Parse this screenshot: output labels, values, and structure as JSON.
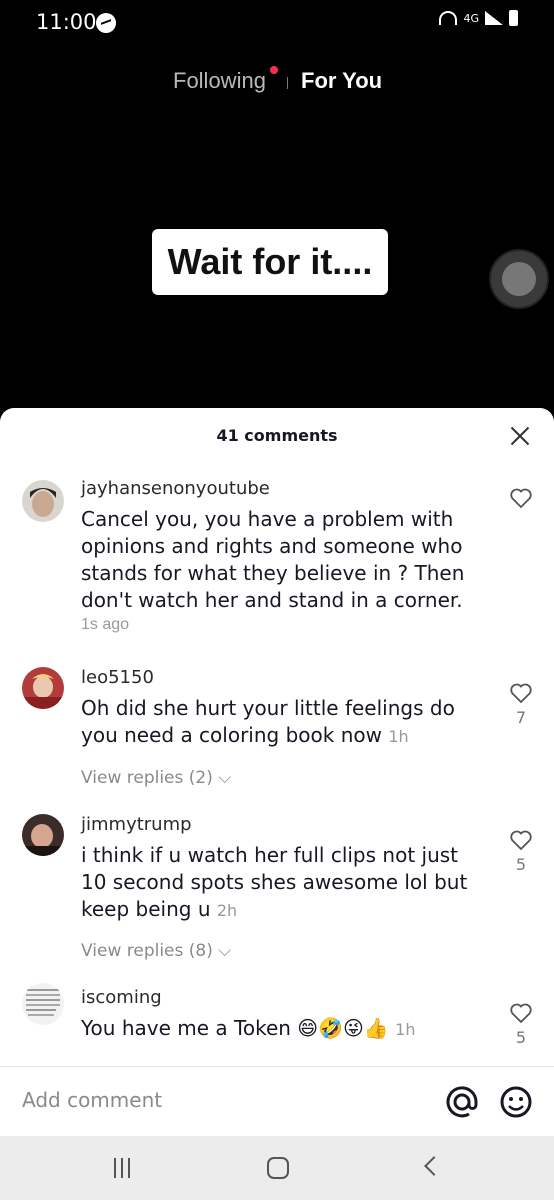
{
  "status_bar": {
    "time": "11:00",
    "network": "4G"
  },
  "top_tabs": {
    "following": "Following",
    "for_you": "For You"
  },
  "video": {
    "caption": "Wait for it...."
  },
  "comments_panel": {
    "count_label": "41 comments",
    "comments": [
      {
        "user": "jayhansenonyoutube",
        "text": "Cancel you, you have a problem with opinions and rights and someone who stands for what they believe in ? Then don't watch her and stand in a corner.",
        "time": "1s ago",
        "likes": "",
        "replies": ""
      },
      {
        "user": "leo5150",
        "text": "Oh did she hurt your little feelings do you need a coloring book now￼￼",
        "time": "1h",
        "likes": "7",
        "replies": "View replies (2)"
      },
      {
        "user": "jimmytrump",
        "text": "i think if u watch her full clips not just 10 second spots shes awesome lol but keep being u",
        "time": "2h",
        "likes": "5",
        "replies": "View replies (8)"
      },
      {
        "user": "iscoming",
        "text": "You have me a Token 😄🤣😜👍",
        "time": "1h",
        "likes": "5",
        "replies": ""
      }
    ]
  },
  "input_bar": {
    "placeholder": "Add comment"
  },
  "icons": {
    "close": "close-icon",
    "heart": "heart-icon",
    "mention": "at-icon",
    "emoji": "emoji-icon",
    "chevron": "chevron-down-icon"
  },
  "colors": {
    "accent": "#fe2c55",
    "text": "#161823",
    "muted": "#8a8a8a"
  }
}
